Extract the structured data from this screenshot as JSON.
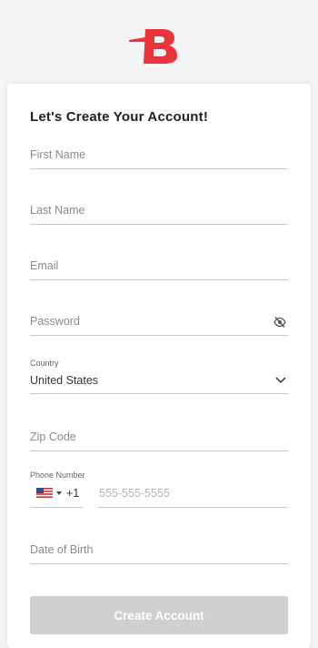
{
  "brand": {
    "logo_letter": "B",
    "accent_color": "#e8343a"
  },
  "form": {
    "title": "Let's Create Your Account!",
    "first_name_placeholder": "First Name",
    "last_name_placeholder": "Last Name",
    "email_placeholder": "Email",
    "password_placeholder": "Password",
    "country_label": "Country",
    "country_value": "United States",
    "zip_placeholder": "Zip Code",
    "phone_label": "Phone Number",
    "phone_country_code": "+1",
    "phone_placeholder": "555-555-5555",
    "dob_placeholder": "Date of Birth",
    "submit_label": "Create Account"
  },
  "icons": {
    "password_toggle": "eye-slash-icon",
    "country_dropdown": "chevron-down-icon",
    "phone_flag": "us-flag-icon",
    "phone_caret": "caret-down-icon"
  }
}
